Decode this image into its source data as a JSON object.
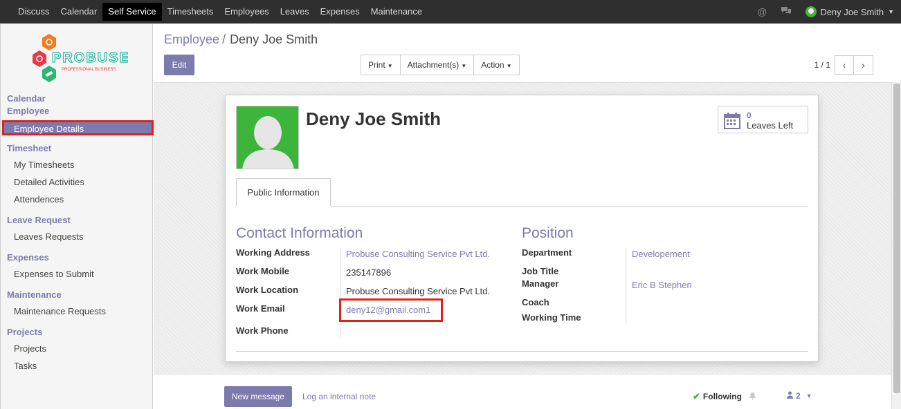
{
  "topnav": {
    "items": [
      "Discuss",
      "Calendar",
      "Self Service",
      "Timesheets",
      "Employees",
      "Leaves",
      "Expenses",
      "Maintenance"
    ],
    "active": "Self Service",
    "user_name": "Deny Joe Smith"
  },
  "logo": {
    "name": "PROBUSE",
    "tagline": "PROFESSIONAL BUSINESS"
  },
  "sidebar": {
    "sections": [
      {
        "title": "Calendar"
      },
      {
        "title": "Employee",
        "items": [
          "Employee Details"
        ]
      },
      {
        "title": "Timesheet",
        "items": [
          "My Timesheets",
          "Detailed Activities",
          "Attendences"
        ]
      },
      {
        "title": "Leave Request",
        "items": [
          "Leaves Requests"
        ]
      },
      {
        "title": "Expenses",
        "items": [
          "Expenses to Submit"
        ]
      },
      {
        "title": "Maintenance",
        "items": [
          "Maintenance Requests"
        ]
      },
      {
        "title": "Projects",
        "items": [
          "Projects",
          "Tasks"
        ]
      }
    ],
    "active_item": "Employee Details"
  },
  "breadcrumb": {
    "parent": "Employee",
    "current": "Deny Joe Smith"
  },
  "toolbar": {
    "edit_label": "Edit",
    "print_label": "Print",
    "attachments_label": "Attachment(s)",
    "action_label": "Action"
  },
  "pager": {
    "value": "1 / 1"
  },
  "employee": {
    "name": "Deny Joe Smith",
    "leaves_left_count": "0",
    "leaves_left_label": "Leaves Left"
  },
  "tab": {
    "label": "Public Information"
  },
  "contact": {
    "title": "Contact Information",
    "working_address_label": "Working Address",
    "working_address": "Probuse Consulting Service Pvt Ltd.",
    "work_mobile_label": "Work Mobile",
    "work_mobile": "235147896",
    "work_location_label": "Work Location",
    "work_location": "Probuse Consulting Service Pvt Ltd.",
    "work_email_label": "Work Email",
    "work_email": "deny12@gmail.com1",
    "work_phone_label": "Work Phone",
    "work_phone": ""
  },
  "position": {
    "title": "Position",
    "department_label": "Department",
    "department": "Developement",
    "job_title_label": "Job Title",
    "manager_label": "Manager",
    "manager": "Eric B Stephen",
    "coach_label": "Coach",
    "working_time_label": "Working Time"
  },
  "chatter": {
    "new_message_label": "New message",
    "log_note_label": "Log an internal note",
    "following_label": "Following",
    "followers_count": "2"
  },
  "colors": {
    "accent": "#7c7bad",
    "highlight": "#e3211b",
    "topbar": "#2f2f2f"
  }
}
